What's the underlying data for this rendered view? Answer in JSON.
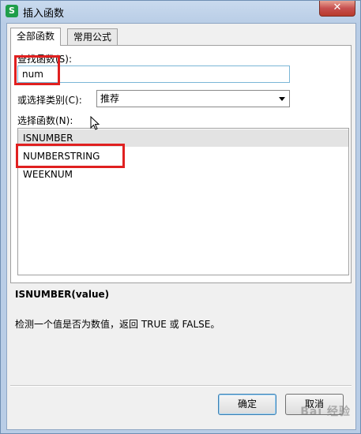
{
  "window": {
    "title": "插入函数",
    "app_icon_letter": "S",
    "close_symbol": "✕"
  },
  "tabs": [
    {
      "label": "全部函数",
      "active": true
    },
    {
      "label": "常用公式",
      "active": false
    }
  ],
  "search": {
    "label": "查找函数(S):",
    "value": "num"
  },
  "category": {
    "label": "或选择类别(C):",
    "selected": "推荐"
  },
  "function_list": {
    "label": "选择函数(N):",
    "items": [
      "ISNUMBER",
      "NUMBERSTRING",
      "WEEKNUM"
    ],
    "selected_index": 0
  },
  "syntax": "ISNUMBER(value)",
  "description": "检测一个值是否为数值，返回 TRUE 或 FALSE。",
  "buttons": {
    "ok": "确定",
    "cancel": "取消"
  },
  "watermark": "Bai 经验",
  "colors": {
    "highlight": "#e02020",
    "title_bar": "#b9cde6",
    "app_icon": "#1f9e4a"
  }
}
